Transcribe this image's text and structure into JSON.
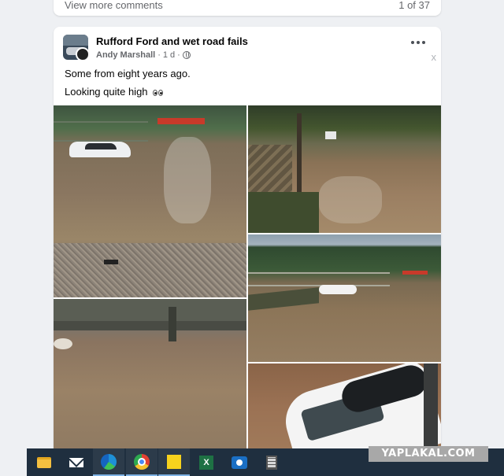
{
  "prev_post": {
    "view_more": "View more comments",
    "count": "1 of 37"
  },
  "post": {
    "group_name": "Rufford Ford and wet road fails",
    "author": "Andy Marshall",
    "separator": "·",
    "time": "1 d",
    "time_separator": "·",
    "close": "x",
    "text_line1": "Some from eight years ago.",
    "text_line2": "Looking quite high"
  },
  "photos": [
    {
      "name": "flooded-ford-photo-1"
    },
    {
      "name": "flooded-road-photo-2"
    },
    {
      "name": "flooded-road-photo-3"
    },
    {
      "name": "flooded-ford-photo-4"
    },
    {
      "name": "flooded-car-photo-5"
    }
  ],
  "taskbar": {
    "apps": [
      "file-explorer",
      "mail",
      "edge",
      "chrome",
      "sticky-notes",
      "excel",
      "camera",
      "calculator"
    ],
    "excel_letter": "X"
  },
  "watermark": "YAPLAKAL.COM",
  "colors": {
    "page_bg": "#eef0f3",
    "card_bg": "#ffffff",
    "taskbar_bg": "#1f2f3f",
    "secondary_text": "#65676b"
  }
}
